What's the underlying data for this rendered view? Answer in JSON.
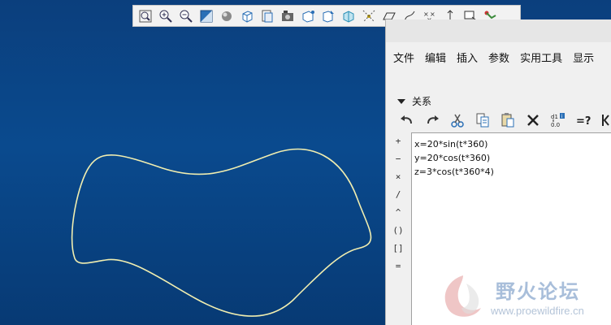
{
  "top_toolbar": {
    "icons": [
      "zoom-fit-icon",
      "zoom-in-icon",
      "zoom-out-icon",
      "repaint-icon",
      "shading-icon",
      "view-orient-icon",
      "saved-views-icon",
      "display-style-icon",
      "datum-plane-icon",
      "datum-axis-icon",
      "datum-csys-icon",
      "spin-center-icon",
      "sketch-plane-icon",
      "curve-icon",
      "point-icon",
      "annotation-icon",
      "appearance-icon",
      "layers-icon"
    ]
  },
  "menubar": {
    "items": [
      "文件",
      "编辑",
      "插入",
      "参数",
      "实用工具",
      "显示"
    ]
  },
  "relations": {
    "section_title": "关系",
    "operators": [
      "+",
      "−",
      "×",
      "/",
      "^",
      "()",
      "[]",
      "="
    ],
    "lines": [
      "x=20*sin(t*360)",
      "y=20*cos(t*360)",
      "z=3*cos(t*360*4)"
    ]
  },
  "watermark": {
    "title": "野火论坛",
    "url": "www.proewildfire.cn"
  },
  "colors": {
    "background_top": "#0b3f7d",
    "curve": "#f1eeb0",
    "dialog_bg": "#f0f0f0"
  }
}
